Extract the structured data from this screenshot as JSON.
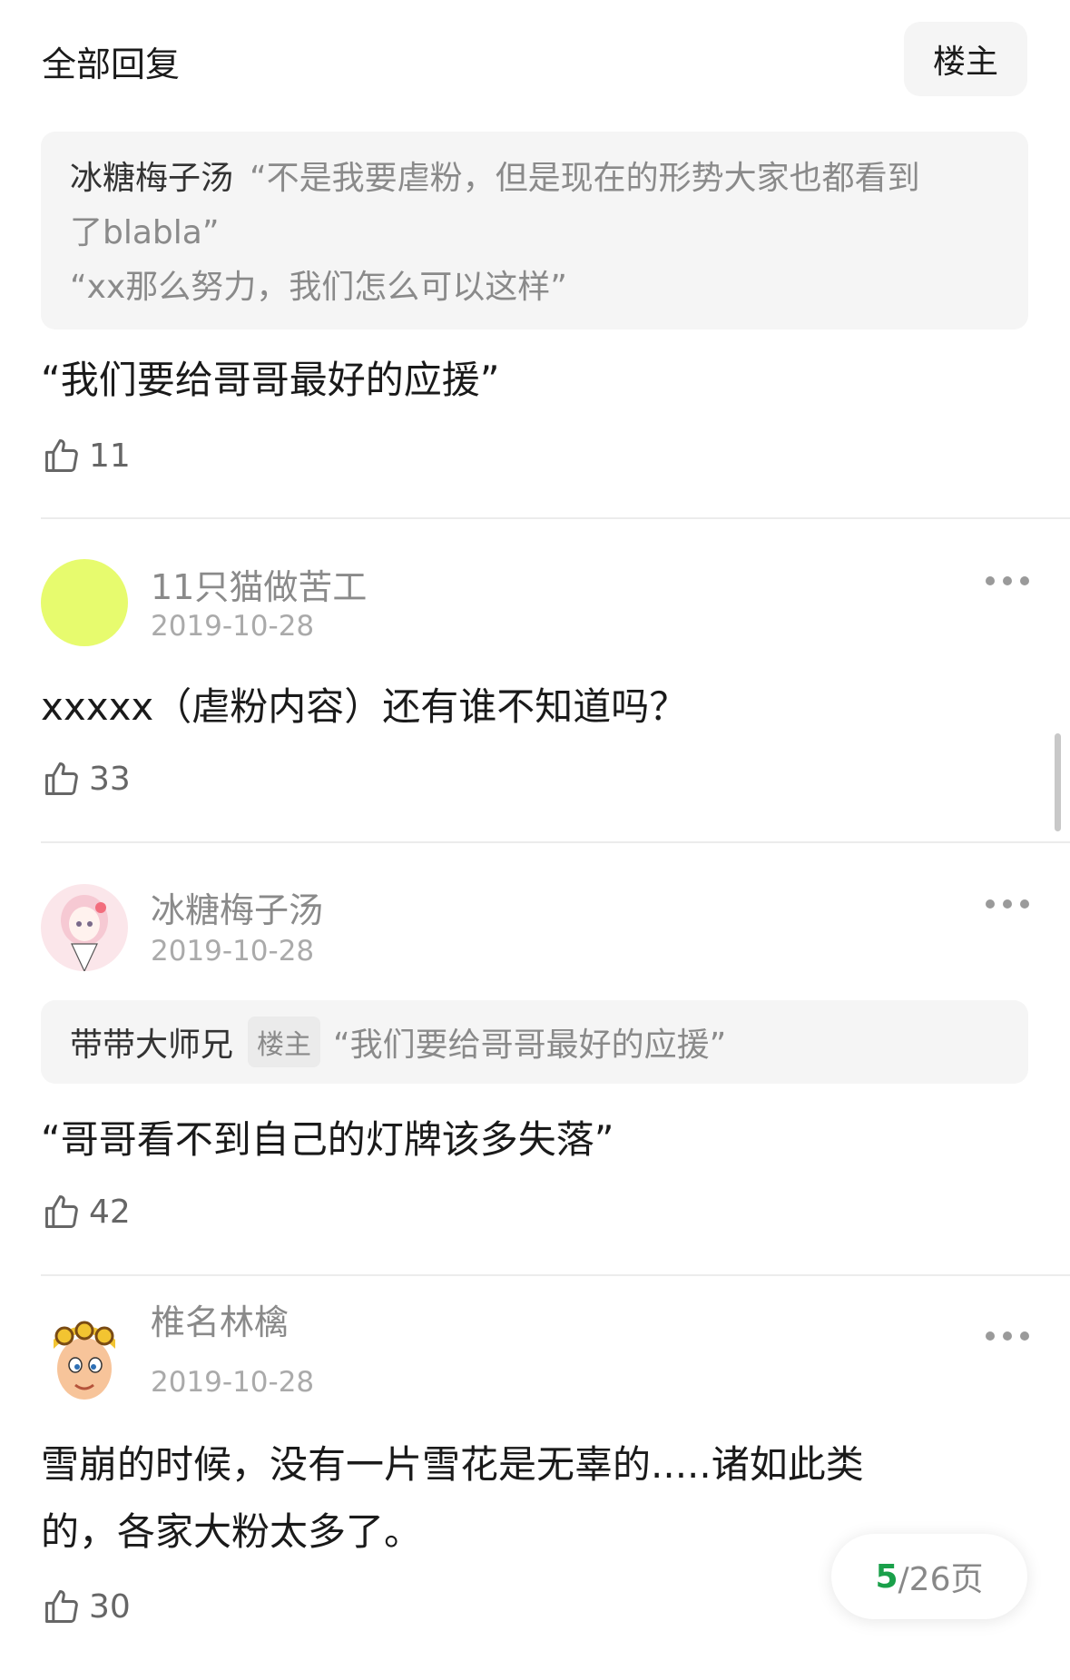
{
  "header": {
    "title": "全部回复",
    "op_filter_label": "楼主"
  },
  "top_reply": {
    "quote": {
      "author": "冰糖梅子汤",
      "line1": "“不是我要虐粉，但是现在的形势大家也都看到",
      "line2": "了blabla”",
      "line3": "“xx那么努力，我们怎么可以这样”"
    },
    "text": "“我们要给哥哥最好的应援”",
    "likes": "11"
  },
  "replies": [
    {
      "username": "11只猫做苦工",
      "date": "2019-10-28",
      "text": "xxxxx（虐粉内容）还有谁不知道吗？",
      "likes": "33",
      "avatar_color": "#e7fb6e"
    },
    {
      "username": "冰糖梅子汤",
      "date": "2019-10-28",
      "quote": {
        "author": "带带大师兄",
        "badge": "楼主",
        "text": "“我们要给哥哥最好的应援”"
      },
      "text": "“哥哥看不到自己的灯牌该多失落”",
      "likes": "42"
    },
    {
      "username": "椎名林檎",
      "date": "2019-10-28",
      "text_line1": "雪崩的时候，没有一片雪花是无辜的.....诸如此类",
      "text_line2": "的，各家大粉太多了。",
      "likes": "30"
    }
  ],
  "pagination": {
    "current": "5",
    "total": "/26页"
  },
  "colors": {
    "accent": "#1aa04a",
    "quote_bg": "#f5f5f5",
    "muted": "#8a8a8a"
  }
}
